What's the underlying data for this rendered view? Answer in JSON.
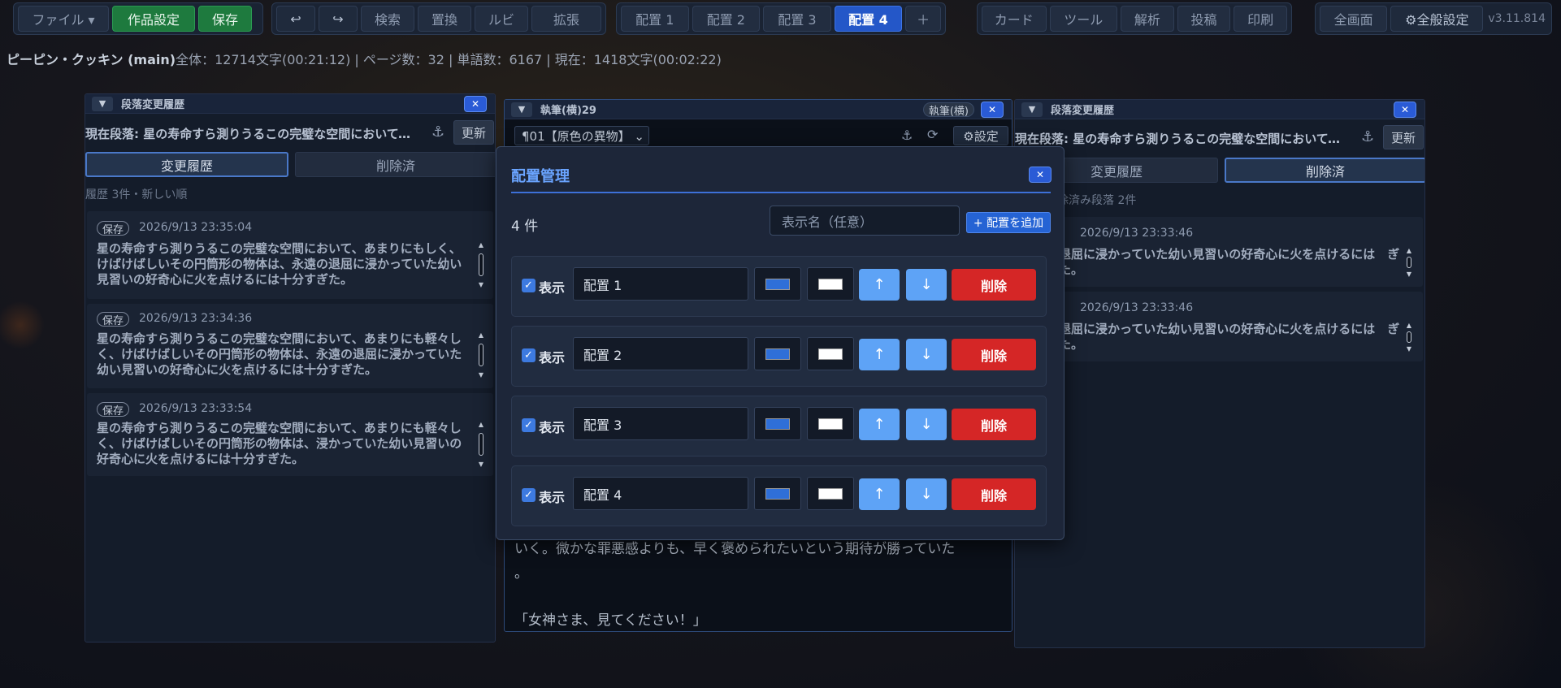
{
  "toolbar": {
    "file": "ファイル ▾",
    "work_settings": "作品設定",
    "save": "保存",
    "undo": "↩",
    "redo": "↪",
    "search": "検索",
    "replace": "置換",
    "ruby": "ルビ",
    "extend": "拡張",
    "layouts": [
      "配置 1",
      "配置 2",
      "配置 3",
      "配置 4"
    ],
    "add_layout": "＋",
    "card": "カード",
    "tools": "ツール",
    "analysis": "解析",
    "post": "投稿",
    "print": "印刷",
    "fullscreen": "全画面",
    "global_settings": "⚙全般設定",
    "version": "v3.11.814"
  },
  "status": {
    "project": "ピーピン・クッキン (main)",
    "stats": "全体：12714文字(00:21:12) | ページ数：32 | 単語数：6167 | 現在：1418文字(00:02:22)"
  },
  "left_panel": {
    "collapse": "▼",
    "title": "段落変更履歴",
    "close": "✕",
    "current": "現在段落: 星の寿命すら測りうるこの完璧な空間において、あ…",
    "anchor": "⚓",
    "refresh": "更新",
    "tab_history": "変更履歴",
    "tab_deleted": "削除済",
    "meta": "履歴 3件・新しい順",
    "entries": [
      {
        "badge": "保存",
        "time": "2026/9/13 23:35:04",
        "text": "星の寿命すら測りうるこの完璧な空間において、あまりにもしく、けばけばしいその円筒形の物体は、永遠の退屈に浸かっていた幼い見習いの好奇心に火を点けるには十分すぎた。"
      },
      {
        "badge": "保存",
        "time": "2026/9/13 23:34:36",
        "text": "星の寿命すら測りうるこの完璧な空間において、あまりにも軽々しく、けばけばしいその円筒形の物体は、永遠の退屈に浸かっていた幼い見習いの好奇心に火を点けるには十分すぎた。"
      },
      {
        "badge": "保存",
        "time": "2026/9/13 23:33:54",
        "text": "星の寿命すら測りうるこの完璧な空間において、あまりにも軽々しく、けばけばしいその円筒形の物体は、浸かっていた幼い見習いの好奇心に火を点けるには十分すぎた。"
      }
    ]
  },
  "editor_panel": {
    "collapse": "▼",
    "title": "執筆(横)29",
    "mode_badge": "執筆(横)",
    "close": "✕",
    "chapter": "¶01【原色の異物】 ⌄",
    "anchor": "⚓",
    "reload": "⟳",
    "settings": "⚙設定",
    "line1": "いく。微かな罪悪感よりも、早く褒められたいという期待が勝っていた",
    "line2": "。",
    "line3": "「女神さま、見てください！」"
  },
  "right_panel": {
    "collapse": "▼",
    "title": "段落変更履歴",
    "close": "✕",
    "current": "現在段落: 星の寿命すら測りうるこの完璧な空間において、あ…",
    "anchor": "⚓",
    "refresh": "更新",
    "tab_history": "変更履歴",
    "tab_deleted": "削除済",
    "meta": "除済み段落 2件",
    "entries": [
      {
        "time": "2026/9/13 23:33:46",
        "text": "退屈に浸かっていた幼い見習いの好奇心に火を点けるには　ぎた。"
      },
      {
        "time": "2026/9/13 23:33:46",
        "text": "退屈に浸かっていた幼い見習いの好奇心に火を点けるには　ぎた。"
      }
    ]
  },
  "modal": {
    "title": "配置管理",
    "close": "✕",
    "count": "4 件",
    "name_placeholder": "表示名（任意）",
    "add_button": "+ 配置を追加",
    "show_label": "表示",
    "up": "↑",
    "down": "↓",
    "delete": "削除",
    "rows": [
      {
        "name": "配置 1",
        "color": "#2f6fd8",
        "bg": "#ffffff"
      },
      {
        "name": "配置 2",
        "color": "#2f6fd8",
        "bg": "#ffffff"
      },
      {
        "name": "配置 3",
        "color": "#2f6fd8",
        "bg": "#ffffff"
      },
      {
        "name": "配置 4",
        "color": "#2f6fd8",
        "bg": "#ffffff"
      }
    ]
  }
}
